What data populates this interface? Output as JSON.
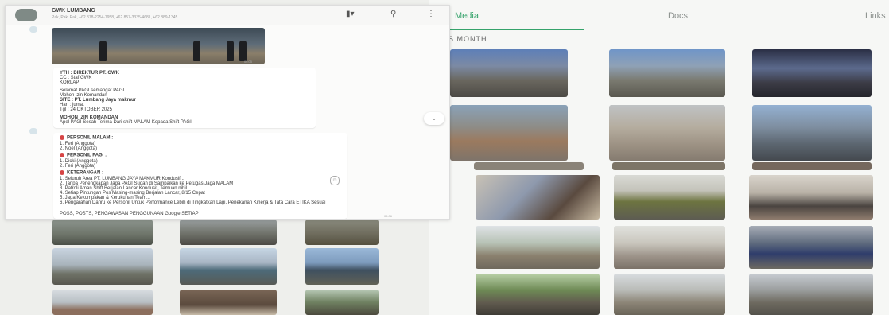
{
  "media_panel": {
    "tabs": [
      {
        "label": "Media",
        "active": true
      },
      {
        "label": "Docs",
        "active": false
      },
      {
        "label": "Links",
        "active": false
      }
    ],
    "section_label": "S MONTH",
    "accent_color": "#35a36b"
  },
  "chat": {
    "title": "GWK LUMBANG",
    "subtitle": "Pak, Pak, Pak, +62 878-2254-7958, +62 857-3335-4681, +62 889-1345 ...",
    "header_icons": [
      "video-call-icon",
      "search-icon",
      "more-options-icon"
    ],
    "photo_time": "06:05",
    "message1": {
      "lines": [
        {
          "text": "YTH : DIREKTUR PT. GWK",
          "bold": true
        },
        {
          "text": "CC : Staf GWK",
          "bold": false
        },
        {
          "text": "KORLAP",
          "bold": false
        },
        {
          "text": "",
          "bold": false
        },
        {
          "text": "Selamat PAGI semangat PAGI",
          "bold": false
        },
        {
          "text": "Mohon izin Komandan",
          "bold": false
        },
        {
          "text": "SITE       : PT. Lumbang Jaya makmur",
          "bold": true
        },
        {
          "text": "Hari       : jumat",
          "bold": false
        },
        {
          "text": "Tgl        : 24 OKTOBER 2025",
          "bold": false
        },
        {
          "text": "",
          "bold": false
        },
        {
          "text": "MOHON IZIN KOMANDAN",
          "bold": true
        },
        {
          "text": "Apel PAGI Sesah Terima Dari shift MALAM Kepada Shift PAGI",
          "bold": false
        }
      ]
    },
    "message2": {
      "sections": [
        {
          "heading": "PERSONIL MALAM :",
          "items": [
            "1. Feri (Anggota)",
            "2. Noel (Anggota)"
          ]
        },
        {
          "heading": "PERSONIL PAGI :",
          "items": [
            "1. Dicki (Anggota)",
            "2. Feri (Anggota)"
          ]
        }
      ],
      "notes_heading": "KETERANGAN :",
      "notes": [
        "1. Seluruh Area PT. LUMBANG JAYA MAKMUR Kondusif...",
        "2. Tanpa Perlengkapan Jaga PAGI Sudah di Sampaikan ke Petugas Jaga MALAM",
        "3. Patroli Aman Shift Berjalan Lancar Kondusif, Temuan nihil...",
        "4. Setiap Pintungan Pos Masing-masing Berjalan Lancar, 8/15 Cepat",
        "5. Jaga Kekompakan & Kerukunan Team...",
        "6. Pengarahan Danru ke Personil Untuk Performance Lebih di Tingkatkan Lagi, Penekanan Kinerja & Tata Cara ETIKA Sesuai",
        "   POSS, POSTS, PENGAWASAN PENGGUNAAN Google SETIAP"
      ],
      "time": "06:06"
    }
  }
}
